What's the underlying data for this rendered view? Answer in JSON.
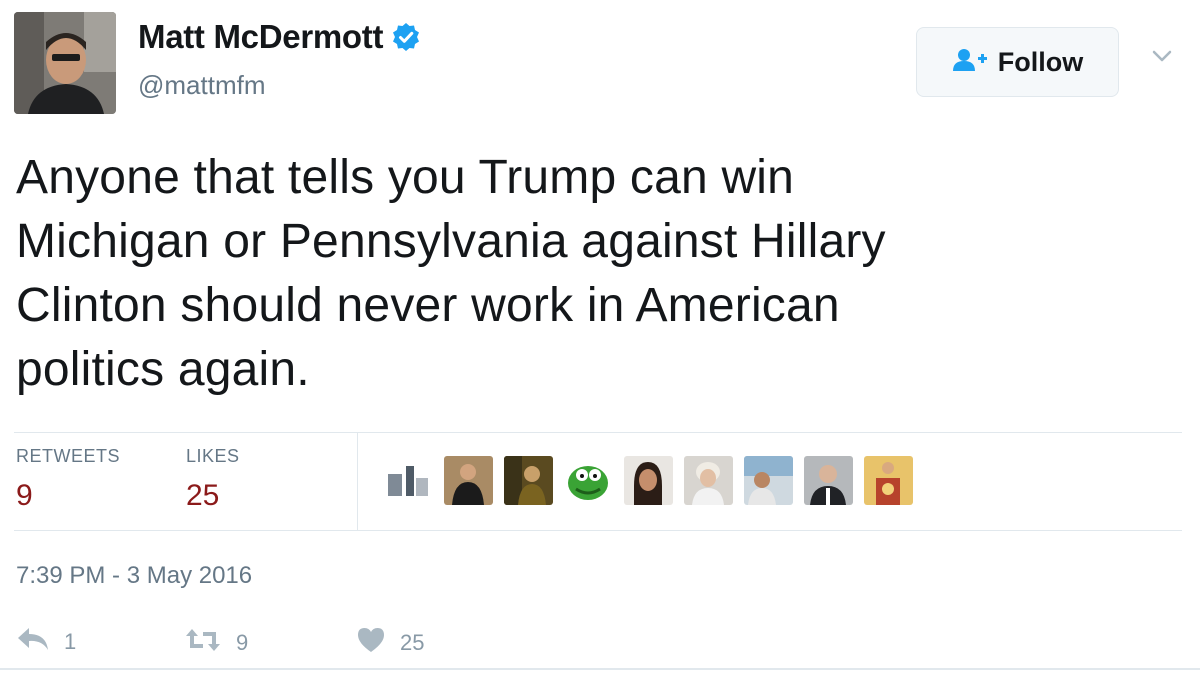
{
  "user": {
    "display_name": "Matt McDermott",
    "handle": "@mattmfm",
    "verified": true
  },
  "follow_button": {
    "label": "Follow"
  },
  "tweet": {
    "text_lines": [
      "Anyone that tells you Trump can win",
      "Michigan or Pennsylvania against Hillary",
      "Clinton should never work in American",
      "politics again."
    ]
  },
  "stats": {
    "retweets_label": "RETWEETS",
    "retweets_value": "9",
    "likes_label": "LIKES",
    "likes_value": "25"
  },
  "timestamp": "7:39 PM - 3 May 2016",
  "actions": {
    "reply_count": "1",
    "retweet_count": "9",
    "like_count": "25"
  },
  "colors": {
    "accent": "#1da1f2",
    "stat_value": "#8b1a1a",
    "muted": "#657786",
    "action_icon": "#aab8c2"
  },
  "icons": {
    "verified": "verified-badge-icon",
    "follow": "add-user-icon",
    "menu": "chevron-down-icon",
    "reply": "reply-icon",
    "retweet": "retweet-icon",
    "like": "heart-icon"
  }
}
